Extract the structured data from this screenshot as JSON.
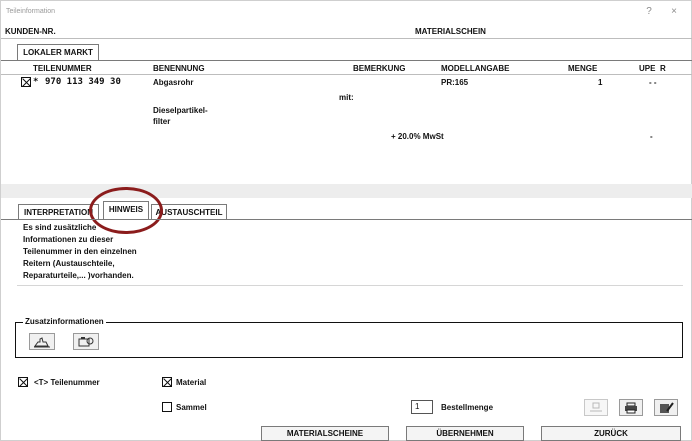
{
  "window": {
    "title": "Teileinformation",
    "help_label": "?",
    "close_label": "×"
  },
  "header": {
    "kunden_label": "KUNDEN-NR.",
    "doc_title": "MATERIALSCHEIN"
  },
  "market_tab": {
    "label": "LOKALER MARKT"
  },
  "columns": {
    "teilenummer": "TEILENUMMER",
    "benennung": "BENENNUNG",
    "bemerkung": "BEMERKUNG",
    "modellangabe": "MODELLANGABE",
    "menge": "MENGE",
    "upe": "UPE",
    "r": "R"
  },
  "row": {
    "part_prefix": "*",
    "part_number": "970 113 349 30",
    "name": "Abgasrohr",
    "remark": "mit:",
    "model": "PR:165",
    "qty": "1",
    "upe": "- -",
    "name_line2": "Dieselpartikel-",
    "name_line3": "filter",
    "vat": "+ 20.0% MwSt",
    "vat_dash": "-"
  },
  "info_tabs": [
    {
      "label": "INTERPRETATION"
    },
    {
      "label": "HINWEIS"
    },
    {
      "label": "AUSTAUSCHTEIL"
    }
  ],
  "hinweis_text": [
    "Es sind zusätzliche",
    "Informationen zu dieser",
    "Teilenummer in den einzelnen",
    "Reitern (Austauschteile,",
    "Reparaturteile,... )vorhanden."
  ],
  "zusatz": {
    "label": "Zusatzinformationen"
  },
  "options": {
    "teilenummer_label": "<T> Teilenummer",
    "material_label": "Material",
    "sammel_label": "Sammel",
    "teilenummer_checked": true,
    "material_checked": true,
    "sammel_checked": false
  },
  "order": {
    "qty_value": "1",
    "bestellmenge_label": "Bestellmenge"
  },
  "buttons": {
    "materialscheine": "MATERIALSCHEINE",
    "uebernehmen": "ÜBERNEHMEN",
    "zurueck": "ZURÜCK"
  },
  "icons": {
    "zusatz_1": "hand-icon",
    "zusatz_2": "camera-icon",
    "disabled_action": "disabled-device-icon",
    "print": "printer-icon",
    "edit": "edit-icon"
  },
  "colors": {
    "highlight_circle": "#8b1c1c"
  }
}
